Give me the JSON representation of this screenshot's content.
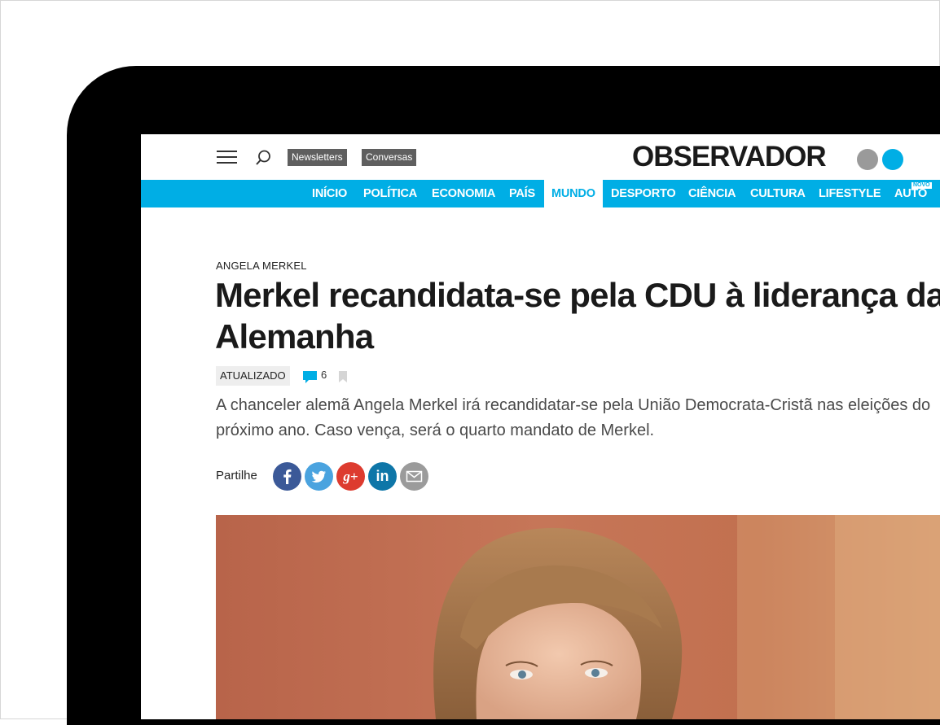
{
  "site": {
    "logo_text": "OBSERVADOR",
    "logo_dot_colors": [
      "#9a9a9a",
      "#00aee5"
    ]
  },
  "header": {
    "menu_icon": "hamburger-icon",
    "search_icon": "search-icon",
    "newsletters_label": "Newsletters",
    "conversas_label": "Conversas"
  },
  "nav": {
    "accent": "#00aee5",
    "items": [
      {
        "label": "INÍCIO"
      },
      {
        "label": "POLÍTICA"
      },
      {
        "label": "ECONOMIA"
      },
      {
        "label": "PAÍS"
      },
      {
        "label": "MUNDO",
        "active": true
      },
      {
        "label": "DESPORTO"
      },
      {
        "label": "CIÊNCIA"
      },
      {
        "label": "CULTURA"
      },
      {
        "label": "LIFESTYLE"
      },
      {
        "label": "AUTO"
      }
    ],
    "novo_badge": "NOVO"
  },
  "article": {
    "kicker": "ANGELA MERKEL",
    "title": "Merkel recandidata-se pela CDU à liderança da Alemanha",
    "updated_label": "ATUALIZADO",
    "comment_count": "6",
    "lead": "A chanceler alemã Angela Merkel irá recandidatar-se pela União Democrata-Cristã nas eleições do próximo ano. Caso vença, será o quarto mandato de Merkel."
  },
  "share": {
    "label": "Partilhe",
    "buttons": [
      {
        "name": "facebook",
        "color": "#3b5998",
        "glyph": "f"
      },
      {
        "name": "twitter",
        "color": "#4aa3df",
        "glyph": ""
      },
      {
        "name": "google-plus",
        "color": "#dd3b2f",
        "glyph": "g+"
      },
      {
        "name": "linkedin",
        "color": "#0e76a8",
        "glyph": "in"
      },
      {
        "name": "email",
        "color": "#9b9b9b",
        "glyph": ""
      }
    ]
  },
  "photo": {
    "subject_icon": "portrait-photo"
  }
}
